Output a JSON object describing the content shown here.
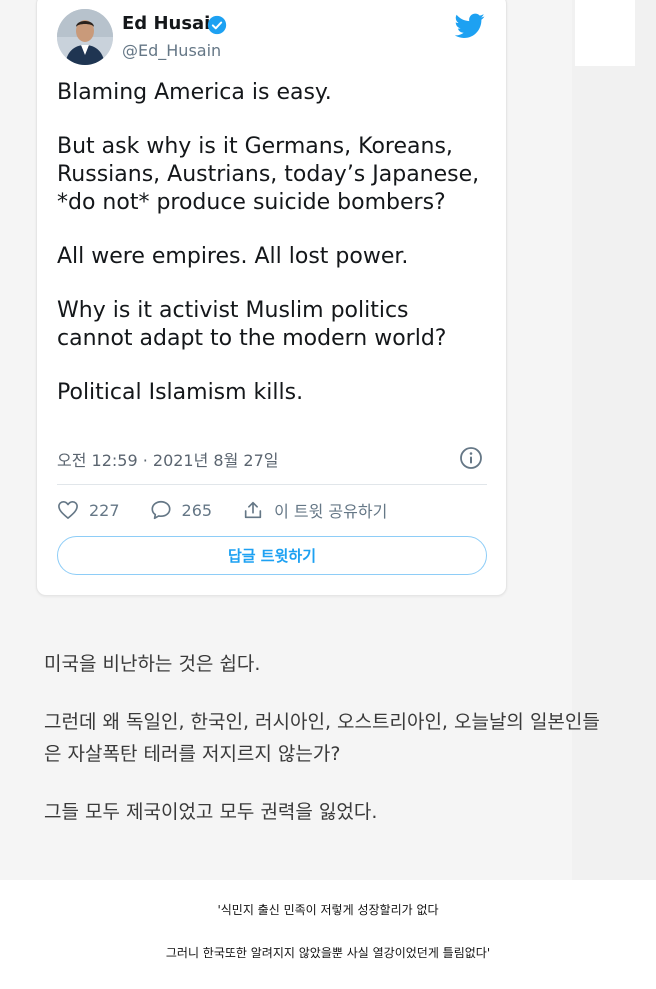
{
  "tweet": {
    "display_name": "Ed Husain",
    "handle": "@Ed_Husain",
    "paragraphs": [
      "Blaming America is easy.",
      "But ask why is it Germans, Koreans,\nRussians, Austrians, today’s Japanese,\n*do not* produce suicide bombers?",
      "All were empires. All lost power.",
      "Why is it activist Muslim politics\ncannot adapt to the modern world?",
      "Political Islamism kills."
    ],
    "timestamp": "오전 12:59 · 2021년 8월 27일",
    "likes": "227",
    "replies": "265",
    "share_label": "이 트윗 공유하기",
    "reply_button_label": "답글 트윗하기"
  },
  "translation": {
    "paragraphs": [
      "미국을 비난하는 것은 쉽다.",
      "그런데 왜 독일인, 한국인, 러시아인, 오스트리아인, 오늘날의 일본인들은 자살폭탄 테러를 저지르지 않는가?",
      "그들 모두 제국이었고 모두 권력을 잃었다."
    ]
  },
  "captions": {
    "line1": "'식민지 출신 민족이 저렇게 성장할리가 없다",
    "line2": "그러니 한국또한 알려지지 않았을뿐 사실 열강이었던게 틀림없다'"
  },
  "colors": {
    "twitter_blue": "#1da1f2",
    "text_primary": "#14171a",
    "text_secondary": "#657786"
  },
  "icons": [
    "avatar-photo",
    "verified-badge-icon",
    "twitter-bird-icon",
    "info-icon",
    "heart-icon",
    "comment-icon",
    "share-icon"
  ]
}
